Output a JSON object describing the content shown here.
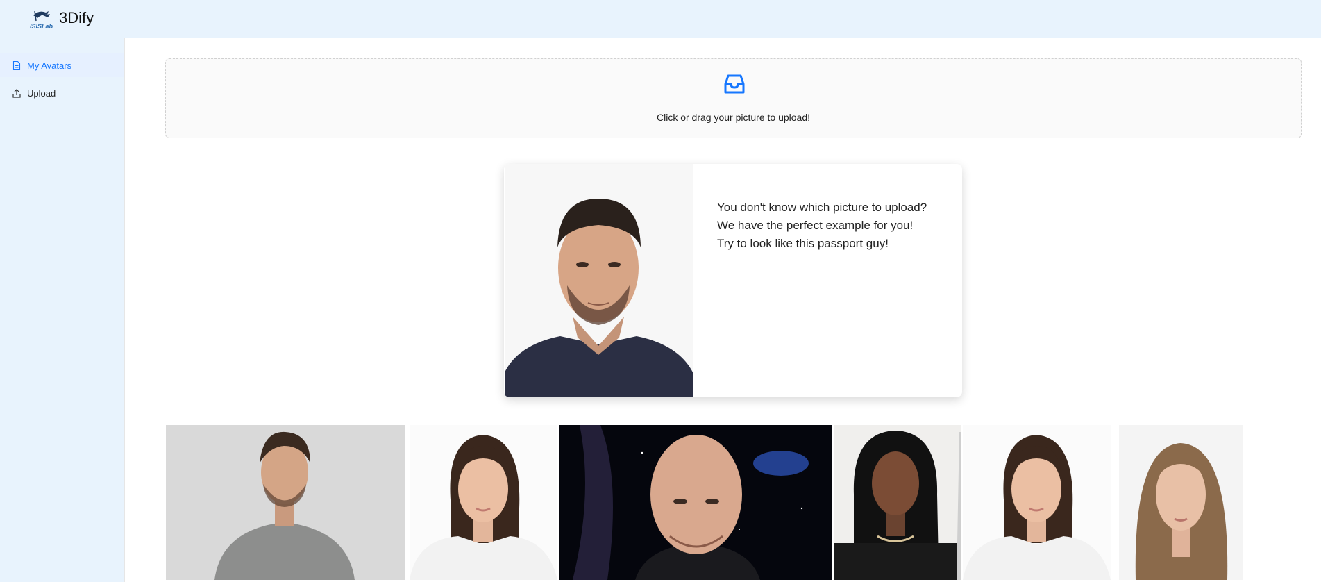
{
  "header": {
    "brand": "3Dify",
    "logo_icon": "isislab-logo-icon"
  },
  "sidebar": {
    "items": [
      {
        "label": "My Avatars",
        "icon": "file-icon",
        "active": true
      },
      {
        "label": "Upload",
        "icon": "upload-icon",
        "active": false
      }
    ]
  },
  "upload": {
    "icon": "inbox-icon",
    "hint": "Click or drag your picture to upload!"
  },
  "example_card": {
    "line1": "You don't know which picture to upload?",
    "line2": "We have the perfect example for you!",
    "line3": "Try to look like this passport guy!"
  },
  "gallery": {
    "count": 6
  },
  "colors": {
    "accent": "#1677ff",
    "sidebar_bg": "#e8f3fd"
  }
}
